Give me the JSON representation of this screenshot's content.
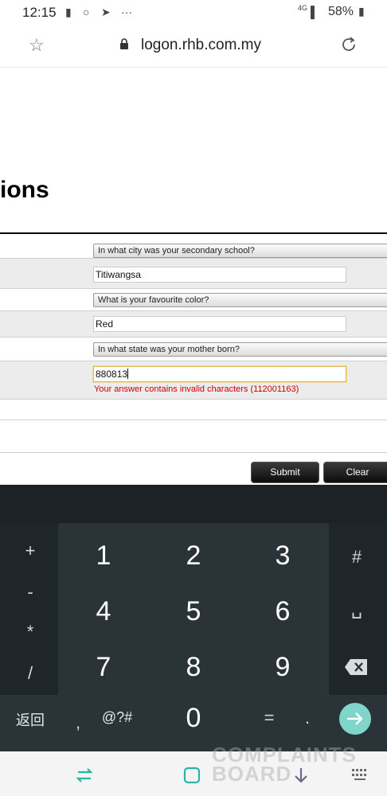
{
  "status_bar": {
    "time": "12:15",
    "network": "4G",
    "battery": "58%",
    "overflow": "···"
  },
  "browser": {
    "url": "logon.rhb.com.my",
    "icons": [
      "star-icon",
      "lock-icon",
      "reload-icon"
    ]
  },
  "page": {
    "heading_visible": "ions",
    "rows": [
      {
        "type": "question",
        "text": "In what city was your secondary school?"
      },
      {
        "type": "answer",
        "value": "Titiwangsa"
      },
      {
        "type": "question",
        "text": "What is your favourite color?"
      },
      {
        "type": "answer",
        "value": "Red"
      },
      {
        "type": "question",
        "text": "In what state was your mother born?"
      },
      {
        "type": "answer",
        "value": "880813",
        "error": "Your answer contains invalid characters (112001163)"
      }
    ],
    "buttons": {
      "submit": "Submit",
      "clear": "Clear"
    }
  },
  "keyboard": {
    "left_column": [
      "+",
      "-",
      "*",
      "/"
    ],
    "right_column": [
      "#",
      "␣"
    ],
    "digits": [
      "1",
      "2",
      "3",
      "4",
      "5",
      "6",
      "7",
      "8",
      "9",
      "0"
    ],
    "bottom_row": {
      "lang": "返回",
      "comma": ",",
      "symbols": "@?#",
      "equals": "=",
      "dot": "."
    },
    "enter_icon": "arrow-right-icon",
    "backspace_icon": "backspace-icon",
    "accent": "#7fd5c9"
  },
  "watermark": {
    "line1": "COMPLAINTS",
    "line2": "BOARD"
  },
  "colors": {
    "error": "#cc0000",
    "row_shade": "#ececec",
    "active_border": "#e0b75a"
  }
}
